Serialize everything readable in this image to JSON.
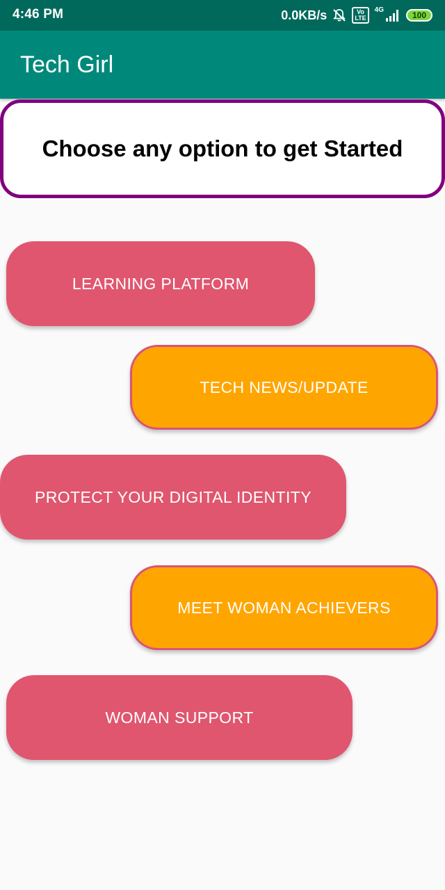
{
  "status_bar": {
    "time": "4:46 PM",
    "network_speed": "0.0KB/s",
    "volte_label": "Vo\nLTE",
    "network_type": "4G",
    "battery_level": "100",
    "icons": [
      "mute-bell-icon",
      "volte-icon",
      "signal-icon",
      "battery-icon"
    ]
  },
  "app_bar": {
    "title": "Tech Girl"
  },
  "header": {
    "text": "Choose any option to get Started"
  },
  "options": [
    {
      "label": "LEARNING PLATFORM",
      "color": "#e0566f"
    },
    {
      "label": "TECH NEWS/UPDATE",
      "color": "#ffa500"
    },
    {
      "label": "PROTECT YOUR DIGITAL IDENTITY",
      "color": "#e0566f"
    },
    {
      "label": "MEET WOMAN ACHIEVERS",
      "color": "#ffa500"
    },
    {
      "label": "WOMAN SUPPORT",
      "color": "#e0566f"
    }
  ],
  "colors": {
    "status_bar": "#00695c",
    "app_bar": "#00897b",
    "header_border": "#800080",
    "pink": "#e0566f",
    "orange": "#ffa500",
    "orange_border": "#d9547a",
    "battery": "#7cd63a"
  }
}
